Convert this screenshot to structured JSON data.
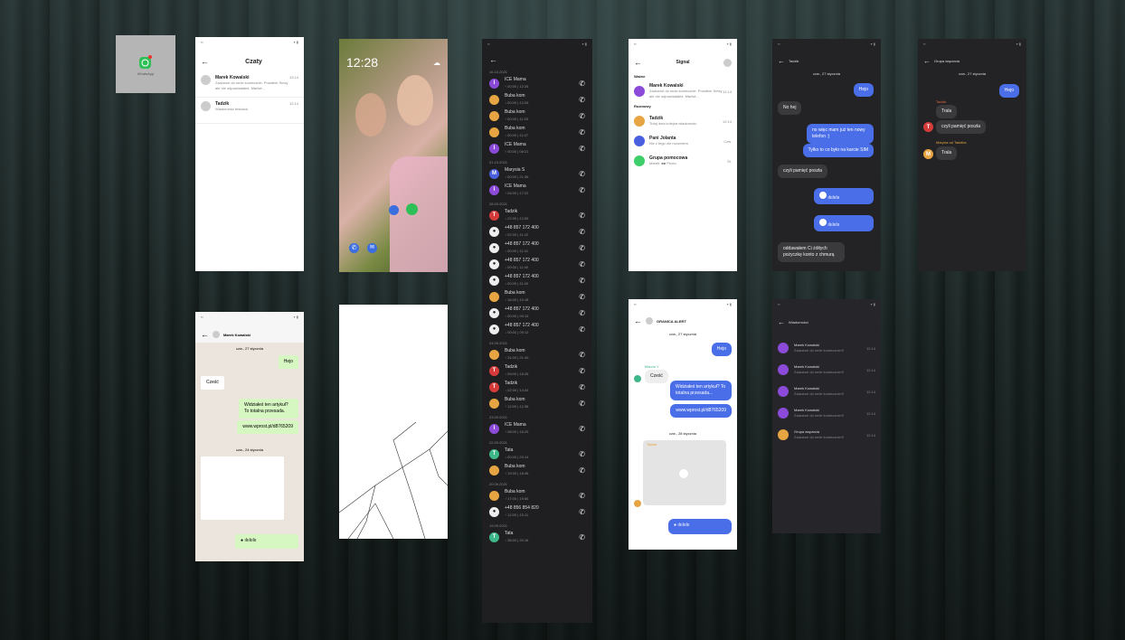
{
  "app_icon": {
    "label": "WhatsApp"
  },
  "wa_chats": {
    "title": "Czaty",
    "items": [
      {
        "name": "Marek Kowalski",
        "msg": "Zadzwoń do mnie koniecznie. Prosiłem Smsy ale nie odpowiadałeś. Martwi...",
        "time": "12:14"
      },
      {
        "name": "Tadzik",
        "msg": "Wiadomość testowa",
        "time": "12:14"
      }
    ]
  },
  "lockscreen": {
    "time": "12:28"
  },
  "calls": {
    "groups": [
      {
        "date": "16.10.2021",
        "rows": [
          {
            "name": "ICE Mama",
            "meta": "↑ 00:00 | 12:28",
            "initial": "I",
            "color": "#8b4bd8"
          },
          {
            "name": "Buba kom",
            "meta": "↓ 00:00 | 12:28",
            "initial": "",
            "color": "#e6a542"
          },
          {
            "name": "Buba kom",
            "meta": "↑ 00:00 | 11:25",
            "initial": "",
            "color": "#e6a542"
          },
          {
            "name": "Buba kom",
            "meta": "↓ 00:00 | 11:07",
            "initial": "",
            "color": "#e6a542"
          },
          {
            "name": "ICE Mama",
            "meta": "↑ 00:00 | 08:21",
            "initial": "I",
            "color": "#8b4bd8"
          }
        ]
      },
      {
        "date": "01.10.2021",
        "rows": [
          {
            "name": "Marysia S",
            "meta": "↓ 00:00 | 21:36",
            "initial": "M",
            "color": "#4a5fe0"
          },
          {
            "name": "ICE Mama",
            "meta": "↑ 04:00 | 17:22",
            "initial": "I",
            "color": "#8b4bd8"
          }
        ]
      },
      {
        "date": "28.09.2021",
        "rows": [
          {
            "name": "Tadzik",
            "meta": "↓ 22:00 | 12:55",
            "initial": "T",
            "color": "#d63b3b"
          },
          {
            "name": "+48 857 172 400",
            "meta": "↓ 02:00 | 11:42",
            "initial": "",
            "color": "#eeeeee"
          },
          {
            "name": "+48 857 172 400",
            "meta": "↓ 00:00 | 11:41",
            "initial": "",
            "color": "#eeeeee"
          },
          {
            "name": "+48 857 172 400",
            "meta": "↓ 00:00 | 11:40",
            "initial": "",
            "color": "#eeeeee"
          },
          {
            "name": "+48 857 172 400",
            "meta": "↓ 00:00 | 11:40",
            "initial": "",
            "color": "#eeeeee"
          },
          {
            "name": "Buba kom",
            "meta": "↓ 16:00 | 10:18",
            "initial": "",
            "color": "#e6a542"
          },
          {
            "name": "+48 857 172 400",
            "meta": "↓ 00:00 | 09:13",
            "initial": "",
            "color": "#eeeeee"
          },
          {
            "name": "+48 857 172 400",
            "meta": "↓ 00:00 | 09:12",
            "initial": "",
            "color": "#eeeeee"
          }
        ]
      },
      {
        "date": "24.09.2021",
        "rows": [
          {
            "name": "Buba kom",
            "meta": "↑ 31:00 | 21:40",
            "initial": "",
            "color": "#e6a542"
          },
          {
            "name": "Tadzik",
            "meta": "↓ 09:00 | 18:28",
            "initial": "T",
            "color": "#d63b3b"
          },
          {
            "name": "Tadzik",
            "meta": "↓ 02:00 | 14:34",
            "initial": "T",
            "color": "#d63b3b"
          },
          {
            "name": "Buba kom",
            "meta": "↑ 12:00 | 12:38",
            "initial": "",
            "color": "#e6a542"
          }
        ]
      },
      {
        "date": "23.09.2021",
        "rows": [
          {
            "name": "ICE Mama",
            "meta": "↑ 08:00 | 16:29",
            "initial": "I",
            "color": "#8b4bd8"
          }
        ]
      },
      {
        "date": "22.09.2021",
        "rows": [
          {
            "name": "Tata",
            "meta": "↓ 00:00 | 20:14",
            "initial": "T",
            "color": "#3fb889"
          },
          {
            "name": "Buba kom",
            "meta": "↑ 19:00 | 18:46",
            "initial": "",
            "color": "#e6a542"
          }
        ]
      },
      {
        "date": "20.09.2021",
        "rows": [
          {
            "name": "Buba kom",
            "meta": "↑ 17:00 | 19:56",
            "initial": "",
            "color": "#e6a542"
          },
          {
            "name": "+48 856 854 820",
            "meta": "↑ 12:00 | 19:11",
            "initial": "",
            "color": "#eeeeee"
          }
        ]
      },
      {
        "date": "19.09.2021",
        "rows": [
          {
            "name": "Tata",
            "meta": "↓ 38:00 | 20:16",
            "initial": "T",
            "color": "#3fb889"
          }
        ]
      }
    ]
  },
  "signal_list": {
    "title": "Signal",
    "important_label": "Ważne",
    "conversations_label": "Rozmowy",
    "items": [
      {
        "name": "Marek Kowalski",
        "msg": "Zadzwoń do mnie koniecznie. Prosiłem Smsy ale nie odpowiadałeś. Martwi...",
        "time": "12:14",
        "color": "#8b4bd8",
        "section": "important"
      },
      {
        "name": "Tadzik",
        "msg": "Tutaj inna kolejna wiadomość",
        "time": "12:14",
        "color": "#e6a542",
        "section": "conv"
      },
      {
        "name": "Pani Jolanta",
        "msg": "Nic z tego nie rozumiem",
        "time": "Czw.",
        "color": "#4a5fe0",
        "section": "conv"
      },
      {
        "name": "Grupa pomocowa",
        "msg": "Marek: ■■ Photo",
        "time": "Śr.",
        "color": "#3fcf6a",
        "section": "conv"
      }
    ]
  },
  "sig_tadzik": {
    "name": "Tadzik",
    "date": "czw., 27 stycznia",
    "messages": [
      {
        "side": "out",
        "text": "Hejo"
      },
      {
        "side": "in",
        "text": "No hej"
      },
      {
        "side": "out",
        "text": "no więc mam już ten nowy telefon :)"
      },
      {
        "side": "out",
        "text": "Tylko to co było na karcie SIM"
      },
      {
        "side": "in",
        "text": "czyli pamięć poszła"
      },
      {
        "side": "in",
        "text": "oddawałem Ci żółtych pożyczkę konto z chmurą"
      }
    ]
  },
  "sig_group": {
    "name": "Grupa wsparcia",
    "date": "czw., 27 stycznia",
    "messages": [
      {
        "side": "out",
        "text": "Hejo"
      },
      {
        "side": "in",
        "author": "Tadzik",
        "text": "Trala"
      },
      {
        "side": "in",
        "initial": "T",
        "color": "#d63b3b",
        "text": "czyli pamięć poszła"
      },
      {
        "side": "in",
        "author": "Maryna od Tadzika",
        "initial": "M",
        "color": "#e6a542",
        "text": "Trala"
      }
    ]
  },
  "messages_app": {
    "title": "Wiadomości",
    "items": [
      {
        "name": "Marek Kowalski",
        "msg": "Zadzwoń do mnie koniecznie!!!",
        "time": "12:14"
      },
      {
        "name": "Marek Kowalski",
        "msg": "Zadzwoń do mnie koniecznie!!!",
        "time": "12:14"
      },
      {
        "name": "Marek Kowalski",
        "msg": "Zadzwoń do mnie koniecznie!!!",
        "time": "12:14"
      },
      {
        "name": "Marek Kowalski",
        "msg": "Zadzwoń do mnie koniecznie!!!",
        "time": "12:14"
      },
      {
        "name": "Grupa wsparcia",
        "msg": "Zadzwoń do mnie koniecznie!!!",
        "time": "12:14"
      }
    ]
  },
  "wa_marek": {
    "name": "Marek Kowalski",
    "date1": "czw., 27 stycznia",
    "date2": "czw., 24 stycznia",
    "messages": [
      {
        "side": "out",
        "text": "Hejo"
      },
      {
        "side": "in",
        "text": "Cześć"
      },
      {
        "side": "out",
        "text": "Widziałeś ten artykuł? To totalna przesada."
      },
      {
        "side": "out",
        "text": "www.wprost.pl/d8765209"
      }
    ]
  },
  "sig_granica": {
    "name": "GRANICA ALERT",
    "date1": "czw., 27 stycznia",
    "date2": "czw., 28 stycznia",
    "sender": "Marcin Y",
    "messages": [
      {
        "side": "out",
        "text": "Hejo"
      },
      {
        "side": "in",
        "text": "Cześć"
      },
      {
        "side": "out",
        "text": "Widziałeś ten artykuł? To totalna przesada..."
      },
      {
        "side": "out",
        "text": "www.wprost.pl/d8765209"
      }
    ],
    "photo_author": "Tadzik"
  }
}
